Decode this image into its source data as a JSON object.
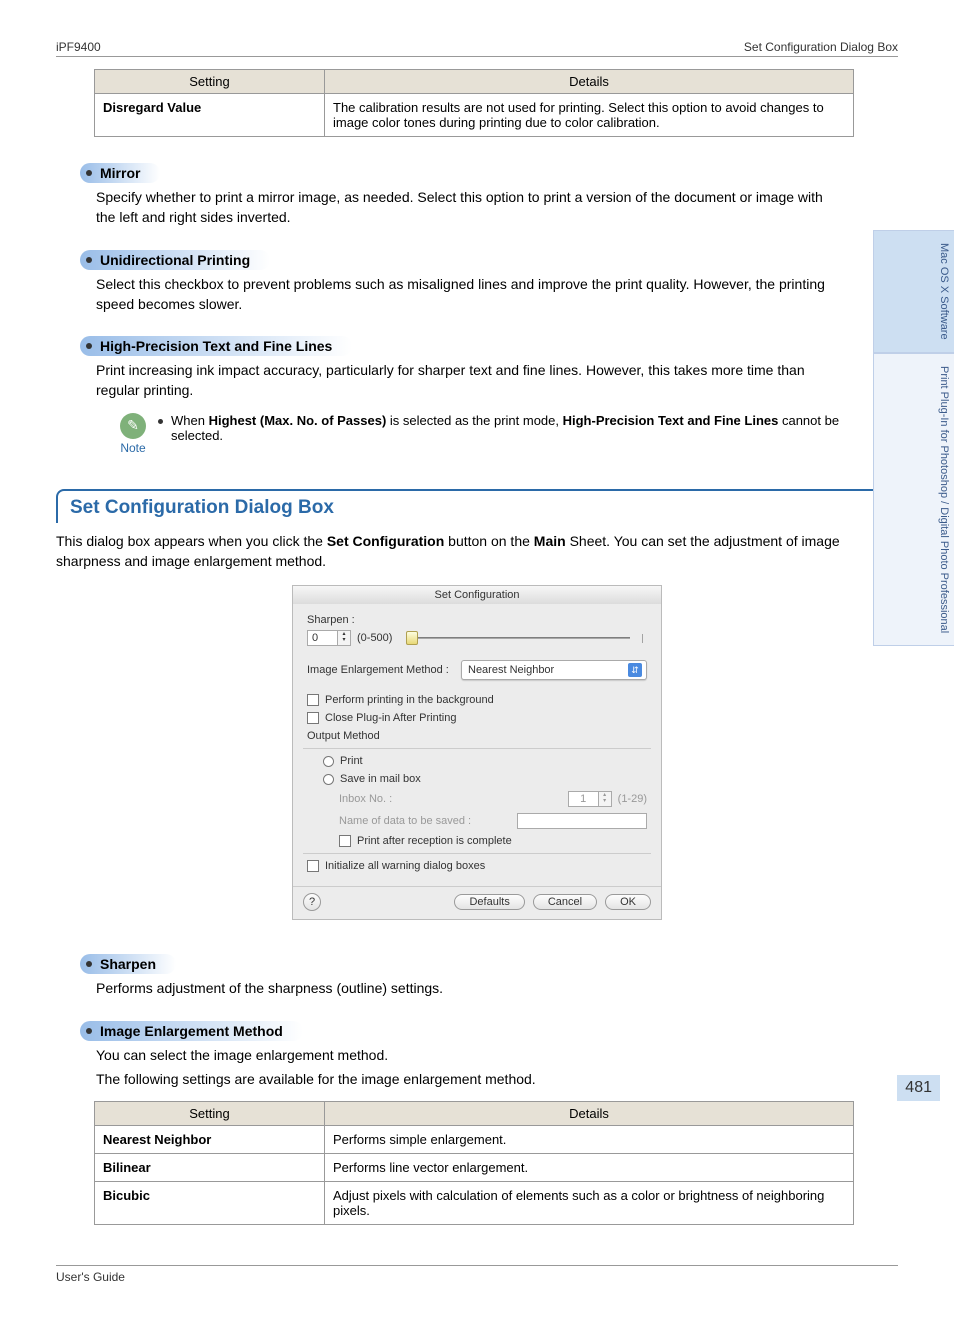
{
  "header": {
    "left": "iPF9400",
    "right": "Set Configuration Dialog Box"
  },
  "calibTable": {
    "headers": [
      "Setting",
      "Details"
    ],
    "rows": [
      {
        "setting": "Disregard Value",
        "details": "The calibration results are not used for printing. Select this option to avoid changes to image color tones during printing due to color calibration."
      }
    ]
  },
  "bullets": {
    "mirror": {
      "title": "Mirror",
      "desc": "Specify whether to print a mirror image, as needed. Select this option to print a version of the document or image with the left and right sides inverted."
    },
    "uni": {
      "title": "Unidirectional Printing",
      "desc": "Select this checkbox to prevent problems such as misaligned lines and improve the print quality. However, the printing speed becomes slower."
    },
    "hp": {
      "title": "High-Precision Text and Fine Lines",
      "desc": "Print increasing ink impact accuracy, particularly for sharper text and fine lines. However, this takes more time than regular printing."
    },
    "sharpen": {
      "title": "Sharpen",
      "desc": "Performs adjustment of the sharpness (outline) settings."
    },
    "iem": {
      "title": "Image Enlargement Method",
      "desc1": "You can select the image enlargement method.",
      "desc2": "The following settings are available for the image enlargement method."
    }
  },
  "note": {
    "label": "Note",
    "text_pre": "When ",
    "bold1": "Highest (Max. No. of Passes)",
    "text_mid": " is selected as the print mode, ",
    "bold2": "High-Precision Text and Fine Lines",
    "text_post": " cannot be selected."
  },
  "section": {
    "title": "Set Configuration Dialog Box",
    "intro_pre": "This dialog box appears when you click the ",
    "intro_b1": "Set Configuration",
    "intro_mid": " button on the ",
    "intro_b2": "Main",
    "intro_post": " Sheet. You can set the adjustment of image sharpness and image enlargement method."
  },
  "dialog": {
    "title": "Set Configuration",
    "sharpen_label": "Sharpen :",
    "sharpen_value": "0",
    "sharpen_range": "(0-500)",
    "iem_label": "Image Enlargement Method :",
    "iem_value": "Nearest Neighbor",
    "bg": "Perform printing in the background",
    "close": "Close Plug-in After Printing",
    "output_method": "Output Method",
    "print": "Print",
    "save": "Save in mail box",
    "inbox_label": "Inbox No. :",
    "inbox_value": "1",
    "inbox_range": "(1-29)",
    "name_label": "Name of data to be saved :",
    "after_recv": "Print after reception is complete",
    "init_warn": "Initialize all warning dialog boxes",
    "defaults": "Defaults",
    "cancel": "Cancel",
    "ok": "OK"
  },
  "enlargeTable": {
    "headers": [
      "Setting",
      "Details"
    ],
    "rows": [
      {
        "setting": "Nearest Neighbor",
        "details": "Performs simple enlargement."
      },
      {
        "setting": "Bilinear",
        "details": "Performs line vector enlargement."
      },
      {
        "setting": "Bicubic",
        "details": "Adjust pixels with calculation of elements such as a color or brightness of neighboring pixels."
      }
    ]
  },
  "sideTabs": {
    "t1": "Mac OS X Software",
    "t2": "Print Plug-In for Photoshop / Digital Photo Professional"
  },
  "pageNum": "481",
  "footer": "User's Guide"
}
